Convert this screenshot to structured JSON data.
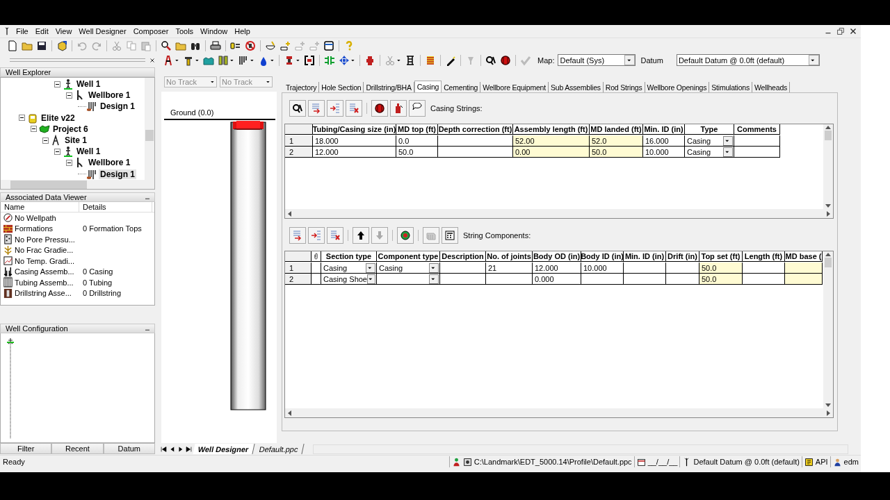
{
  "menu": [
    "File",
    "Edit",
    "View",
    "Well Designer",
    "Composer",
    "Tools",
    "Window",
    "Help"
  ],
  "map": {
    "label": "Map:",
    "value": "Default  (Sys)"
  },
  "datum": {
    "label": "Datum",
    "value": "Default Datum @ 0.0ft (default)"
  },
  "well_explorer": {
    "title": "Well Explorer",
    "tree": [
      {
        "children": [
          {
            "children": [
              {
                "children": [
                  {
                    "children": [
                      {
                        "kind": "well",
                        "label": "Well 1",
                        "expanded": true,
                        "children": [
                          {
                            "kind": "wellbore",
                            "label": "Wellbore 1",
                            "expanded": true,
                            "children": [
                              {
                                "kind": "design",
                                "label": "Design 1",
                                "selected": false
                              }
                            ]
                          }
                        ]
                      }
                    ]
                  }
                ]
              }
            ]
          },
          {
            "kind": "company",
            "label": "Elite v22",
            "expanded": true,
            "children": [
              {
                "kind": "project",
                "label": "Project 6",
                "expanded": true,
                "children": [
                  {
                    "kind": "site",
                    "label": "Site 1",
                    "expanded": true,
                    "children": [
                      {
                        "kind": "well",
                        "label": "Well 1",
                        "expanded": true,
                        "children": [
                          {
                            "kind": "wellbore",
                            "label": "Wellbore 1",
                            "expanded": true,
                            "children": [
                              {
                                "kind": "design",
                                "label": "Design 1",
                                "selected": true
                              }
                            ]
                          }
                        ]
                      }
                    ]
                  }
                ]
              }
            ]
          }
        ]
      }
    ]
  },
  "associated_data_viewer": {
    "title": "Associated Data Viewer",
    "columns": [
      "Name",
      "Details"
    ],
    "rows": [
      {
        "kind": "wellpath",
        "name": "No Wellpath"
      },
      {
        "kind": "formations",
        "name": "Formations",
        "details": "0 Formation Tops"
      },
      {
        "kind": "pore",
        "name": "No Pore Pressu..."
      },
      {
        "kind": "frac",
        "name": "No Frac Gradie..."
      },
      {
        "kind": "temp",
        "name": "No Temp. Gradi..."
      },
      {
        "kind": "casing",
        "name": "Casing Assemb...",
        "details": "0 Casing"
      },
      {
        "kind": "tubing",
        "name": "Tubing Assemb...",
        "details": "0 Tubing"
      },
      {
        "kind": "drillstring",
        "name": "Drillstring Asse...",
        "details": "0 Drillstring"
      }
    ]
  },
  "well_configuration": {
    "title": "Well Configuration"
  },
  "explorer_tabs": [
    "Filter",
    "Recent",
    "Datum"
  ],
  "track": {
    "tracks": [
      "No Track",
      "No Track"
    ],
    "ground_label": "Ground (0.0)"
  },
  "design_tabs": [
    {
      "label": "Trajectory",
      "selected": false
    },
    {
      "label": "Hole Section",
      "selected": false
    },
    {
      "label": "Drillstring/BHA",
      "selected": false
    },
    {
      "label": "Casing",
      "selected": true
    },
    {
      "label": "Cementing",
      "selected": false
    },
    {
      "label": "Wellbore Equipment",
      "selected": false
    },
    {
      "label": "Sub Assemblies",
      "selected": false
    },
    {
      "label": "Rod Strings",
      "selected": false
    },
    {
      "label": "Wellbore Openings",
      "selected": false
    },
    {
      "label": "Stimulations",
      "selected": false
    },
    {
      "label": "Wellheads",
      "selected": false
    }
  ],
  "casing_strings": {
    "title": "Casing Strings:",
    "columns": [
      {
        "label": "Tubing/Casing size (in)",
        "kind": "text",
        "highlighted": false
      },
      {
        "label": "MD top (ft)",
        "kind": "text",
        "highlighted": false
      },
      {
        "label": "Depth correction (ft)",
        "kind": "text",
        "highlighted": false
      },
      {
        "label": "Assembly length (ft)",
        "kind": "text",
        "highlighted": true
      },
      {
        "label": "MD landed (ft)",
        "kind": "text",
        "highlighted": true
      },
      {
        "label": "Min. ID (in)",
        "kind": "text",
        "highlighted": false
      },
      {
        "label": "Type",
        "kind": "dropdown",
        "highlighted": false
      },
      {
        "label": "Comments",
        "kind": "text",
        "highlighted": false
      }
    ],
    "rows": [
      {
        "number": "1",
        "cells": [
          "18.000",
          "0.0",
          null,
          "52.00",
          "52.0",
          "16.000",
          "Casing",
          null
        ]
      },
      {
        "number": "2",
        "cells": [
          "12.000",
          "50.0",
          null,
          "0.00",
          "50.0",
          "10.000",
          "Casing",
          null
        ]
      }
    ]
  },
  "string_components": {
    "title": "String Components:",
    "columns": [
      {
        "kind": "attachment",
        "highlighted": false
      },
      {
        "label": "Section type",
        "kind": "dropdown",
        "highlighted": false
      },
      {
        "label": "Component type",
        "kind": "dropdown",
        "highlighted": false
      },
      {
        "label": "Description",
        "kind": "text",
        "highlighted": false
      },
      {
        "label": "No. of joints",
        "kind": "text",
        "highlighted": false
      },
      {
        "label": "Body OD (in)",
        "kind": "text",
        "highlighted": false
      },
      {
        "label": "Body ID (in)",
        "kind": "text",
        "highlighted": false
      },
      {
        "label": "Min. ID (in)",
        "kind": "text",
        "highlighted": false
      },
      {
        "label": "Drift (in)",
        "kind": "text",
        "highlighted": false
      },
      {
        "label": "Top set (ft)",
        "kind": "text",
        "highlighted": true
      },
      {
        "label": "Length (ft)",
        "kind": "text",
        "highlighted": false
      },
      {
        "label": "MD base (",
        "kind": "text",
        "highlighted": true
      }
    ],
    "rows": [
      {
        "number": "1",
        "cells": [
          null,
          "Casing",
          "Casing",
          null,
          "21",
          "12.000",
          "10.000",
          null,
          null,
          "50.0",
          null,
          null
        ]
      },
      {
        "number": "2",
        "cells": [
          null,
          "Casing Shoe",
          null,
          null,
          null,
          "0.000",
          null,
          null,
          null,
          "50.0",
          null,
          null
        ]
      }
    ]
  },
  "sheet_tabs": [
    {
      "label": "Well Designer",
      "selected": true
    },
    {
      "label": "Default.ppc",
      "selected": false
    }
  ],
  "status_bar": {
    "message": "Ready",
    "profile_path": "C:\\Landmark\\EDT_5000.14\\Profile\\Default.ppc",
    "date": "__/__/__",
    "datum": "Default Datum @ 0.0ft (default)",
    "unit_system": "API",
    "user": "edm"
  }
}
